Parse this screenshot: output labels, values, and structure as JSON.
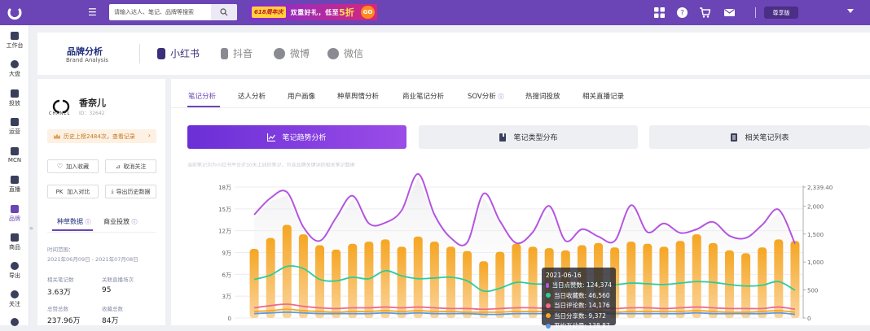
{
  "topbar": {
    "search_placeholder": "请输入达人、笔记、品牌等搜索",
    "banner": {
      "tag": "618周年庆",
      "text": "双重好礼，低至",
      "discount": "5折",
      "go": "GO"
    },
    "tier": "尊享版",
    "icons": [
      "apps-icon",
      "help-icon",
      "cart-icon",
      "mail-icon"
    ]
  },
  "sidebar": {
    "items": [
      {
        "label": "工作台",
        "icon": "dashboard-icon"
      },
      {
        "label": "大盘",
        "icon": "pie-icon"
      },
      {
        "label": "投放",
        "icon": "launch-icon"
      },
      {
        "label": "运营",
        "icon": "chat-icon"
      },
      {
        "label": "MCN",
        "icon": "mcn-icon"
      },
      {
        "label": "直播",
        "icon": "live-icon"
      },
      {
        "label": "品牌",
        "icon": "brand-icon",
        "active": true
      },
      {
        "label": "商品",
        "icon": "goods-icon"
      },
      {
        "label": "导出",
        "icon": "export-icon"
      },
      {
        "label": "关注",
        "icon": "eye-icon"
      }
    ],
    "collapse": "»"
  },
  "brandbar": {
    "title": "品牌分析",
    "subtitle": "Brand Analysis",
    "platforms": [
      "小红书",
      "抖音",
      "微博",
      "微信"
    ]
  },
  "profile": {
    "logo_text": "CHANEL",
    "name": "香奈儿",
    "id": "ID：32642",
    "history": "历史上榜2484次，查看记录",
    "history_arrow": "›",
    "buttons": [
      "加入收藏",
      "取消关注",
      "加入对比",
      "导出历史数据"
    ],
    "pk": "PK",
    "tabs": [
      "种草数据",
      "商业投放"
    ],
    "time_label": "时间范围：",
    "time_range": "2021年06月09日 - 2021年07月08日",
    "stats": [
      {
        "label": "相关笔记数",
        "value": "3.63万"
      },
      {
        "label": "关联直播场次",
        "value": "95"
      },
      {
        "label": "总赞总数",
        "value": "237.96万"
      },
      {
        "label": "收藏总数",
        "value": "84万"
      }
    ]
  },
  "main": {
    "tabs": [
      "笔记分析",
      "达人分析",
      "用户画像",
      "种草舆情分析",
      "商业笔记分析",
      "SOV分析",
      "热搜词投放",
      "相关直播记录"
    ],
    "big_buttons": [
      "笔记趋势分析",
      "笔记类型分布",
      "相关笔记列表"
    ],
    "note_cut": "当前笔记均为小红书平台近30天上线的笔记，包含品牌关键词的相关笔记数据"
  },
  "tooltip": {
    "date": "2021-06-16",
    "rows": [
      {
        "label": "当日点赞数: 124,374",
        "color": "#b455e0"
      },
      {
        "label": "当日收藏数: 46,560",
        "color": "#2ecc9a"
      },
      {
        "label": "当日评论数: 14,176",
        "color": "#f06a8a"
      },
      {
        "label": "当日分享数: 9,372",
        "color": "#f5a623"
      },
      {
        "label": "平均互动量: 138.87",
        "color": "#5b9ae0"
      }
    ]
  },
  "chart_data": {
    "type": "bar",
    "y_left_ticks": [
      "0",
      "3万",
      "6万",
      "9万",
      "12万",
      "15万",
      "18万"
    ],
    "y_right_ticks": [
      "0",
      "500",
      "1,000",
      "1,500",
      "2,000",
      "2,339.40"
    ],
    "ylim_left": [
      0,
      180000
    ],
    "ylim_right": [
      0,
      2339.4
    ],
    "bars": [
      9.5,
      11,
      12.8,
      11.5,
      10,
      9.4,
      10.2,
      10.5,
      10.8,
      9.8,
      11.2,
      10.5,
      9.8,
      9.2,
      7.8,
      9.1,
      10.2,
      9.8,
      9.6,
      9.3,
      10,
      10.3,
      9.7,
      10.5,
      10.2,
      9.8,
      10.6,
      11.5,
      10.3,
      9.3,
      8.9,
      9.7,
      10.8,
      10.6
    ],
    "series": [
      {
        "name": "当日点赞数",
        "color": "#b455e0",
        "values": [
          14.2,
          16.5,
          17.3,
          12.5,
          10.6,
          13.8,
          16.8,
          13,
          13.1,
          14.8,
          19.8,
          14.2,
          11,
          10.4,
          17.1,
          13.3,
          10.3,
          11.8,
          15.4,
          10.6,
          12.2,
          11.2,
          10.6,
          15.5,
          11.8,
          13,
          11.7,
          12.2,
          13.2,
          11.3,
          11,
          12.8,
          14.9,
          10.2
        ]
      },
      {
        "name": "当日收藏数",
        "color": "#2ecc9a",
        "values": [
          5.3,
          5.9,
          7.1,
          6.8,
          5.3,
          5.1,
          5.6,
          5.4,
          6.5,
          5.8,
          5.4,
          5.5,
          5.6,
          5.1,
          3.7,
          4.1,
          4.9,
          4.7,
          4.6,
          4.2,
          4.5,
          4.9,
          4.6,
          4.8,
          4.7,
          4.6,
          4.8,
          5,
          4.9,
          4.6,
          4.4,
          4.5,
          5,
          3.8
        ]
      },
      {
        "name": "当日评论数",
        "color": "#f06a8a",
        "values": [
          1.4,
          1.7,
          1.9,
          1.6,
          1.4,
          1.3,
          1.4,
          1.4,
          1.5,
          1.4,
          1.5,
          1.4,
          1.3,
          1.3,
          1.2,
          1.3,
          1.4,
          1.4,
          1.3,
          1.3,
          1.4,
          1.4,
          1.3,
          1.4,
          1.4,
          1.3,
          1.4,
          1.5,
          1.4,
          1.3,
          1.3,
          1.3,
          1.5,
          1.2
        ]
      },
      {
        "name": "当日分享数",
        "color": "#f5a623",
        "values": [
          0.9,
          1,
          1.2,
          1,
          0.9,
          0.8,
          0.9,
          0.9,
          1,
          0.9,
          1,
          0.9,
          0.9,
          0.8,
          0.8,
          0.8,
          0.9,
          0.9,
          0.9,
          0.8,
          0.9,
          0.9,
          0.8,
          0.9,
          0.9,
          0.9,
          0.9,
          1,
          0.9,
          0.8,
          0.8,
          0.9,
          1,
          0.8
        ]
      },
      {
        "name": "平均互动量",
        "color": "#5b9ae0",
        "values": [
          0.6,
          0.7,
          0.8,
          0.7,
          0.6,
          0.6,
          0.6,
          0.6,
          0.7,
          0.6,
          0.7,
          0.6,
          0.6,
          0.6,
          0.5,
          0.5,
          0.6,
          0.6,
          0.6,
          0.6,
          0.6,
          0.6,
          0.6,
          0.6,
          0.6,
          0.6,
          0.6,
          0.7,
          0.6,
          0.6,
          0.6,
          0.6,
          0.7,
          0.5
        ]
      }
    ]
  }
}
